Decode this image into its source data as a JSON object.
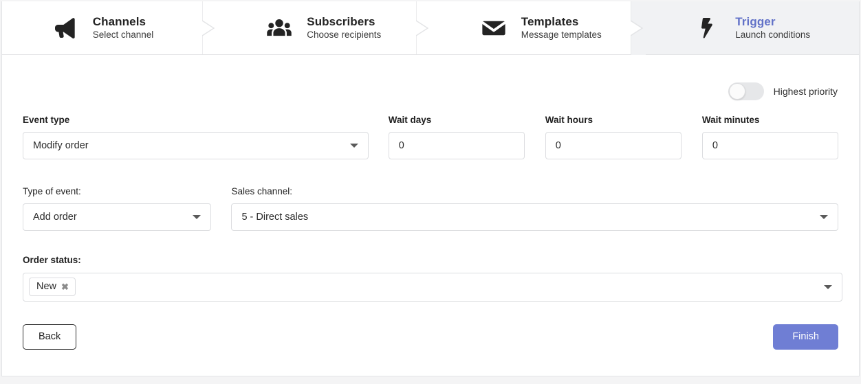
{
  "stepper": {
    "steps": [
      {
        "icon": "megaphone-icon",
        "title": "Channels",
        "subtitle": "Select channel",
        "active": false
      },
      {
        "icon": "people-icon",
        "title": "Subscribers",
        "subtitle": "Choose recipients",
        "active": false
      },
      {
        "icon": "envelope-icon",
        "title": "Templates",
        "subtitle": "Message templates",
        "active": false
      },
      {
        "icon": "bolt-icon",
        "title": "Trigger",
        "subtitle": "Launch conditions",
        "active": true
      }
    ],
    "active_color": "#6272c8",
    "active_bg": "#f1f2f4"
  },
  "priority": {
    "label": "Highest priority",
    "enabled": false
  },
  "fields": {
    "event_type": {
      "label": "Event type",
      "value": "Modify order"
    },
    "wait_days": {
      "label": "Wait days",
      "value": "0"
    },
    "wait_hours": {
      "label": "Wait hours",
      "value": "0"
    },
    "wait_minutes": {
      "label": "Wait minutes",
      "value": "0"
    },
    "type_of_event": {
      "label": "Type of event:",
      "value": "Add order"
    },
    "sales_channel": {
      "label": "Sales channel:",
      "value": "5 - Direct sales"
    },
    "order_status": {
      "label": "Order status:",
      "chips": [
        {
          "label": "New",
          "remove_icon": "close-icon"
        }
      ]
    }
  },
  "actions": {
    "back_label": "Back",
    "finish_label": "Finish",
    "finish_color": "#6f7ed4"
  }
}
